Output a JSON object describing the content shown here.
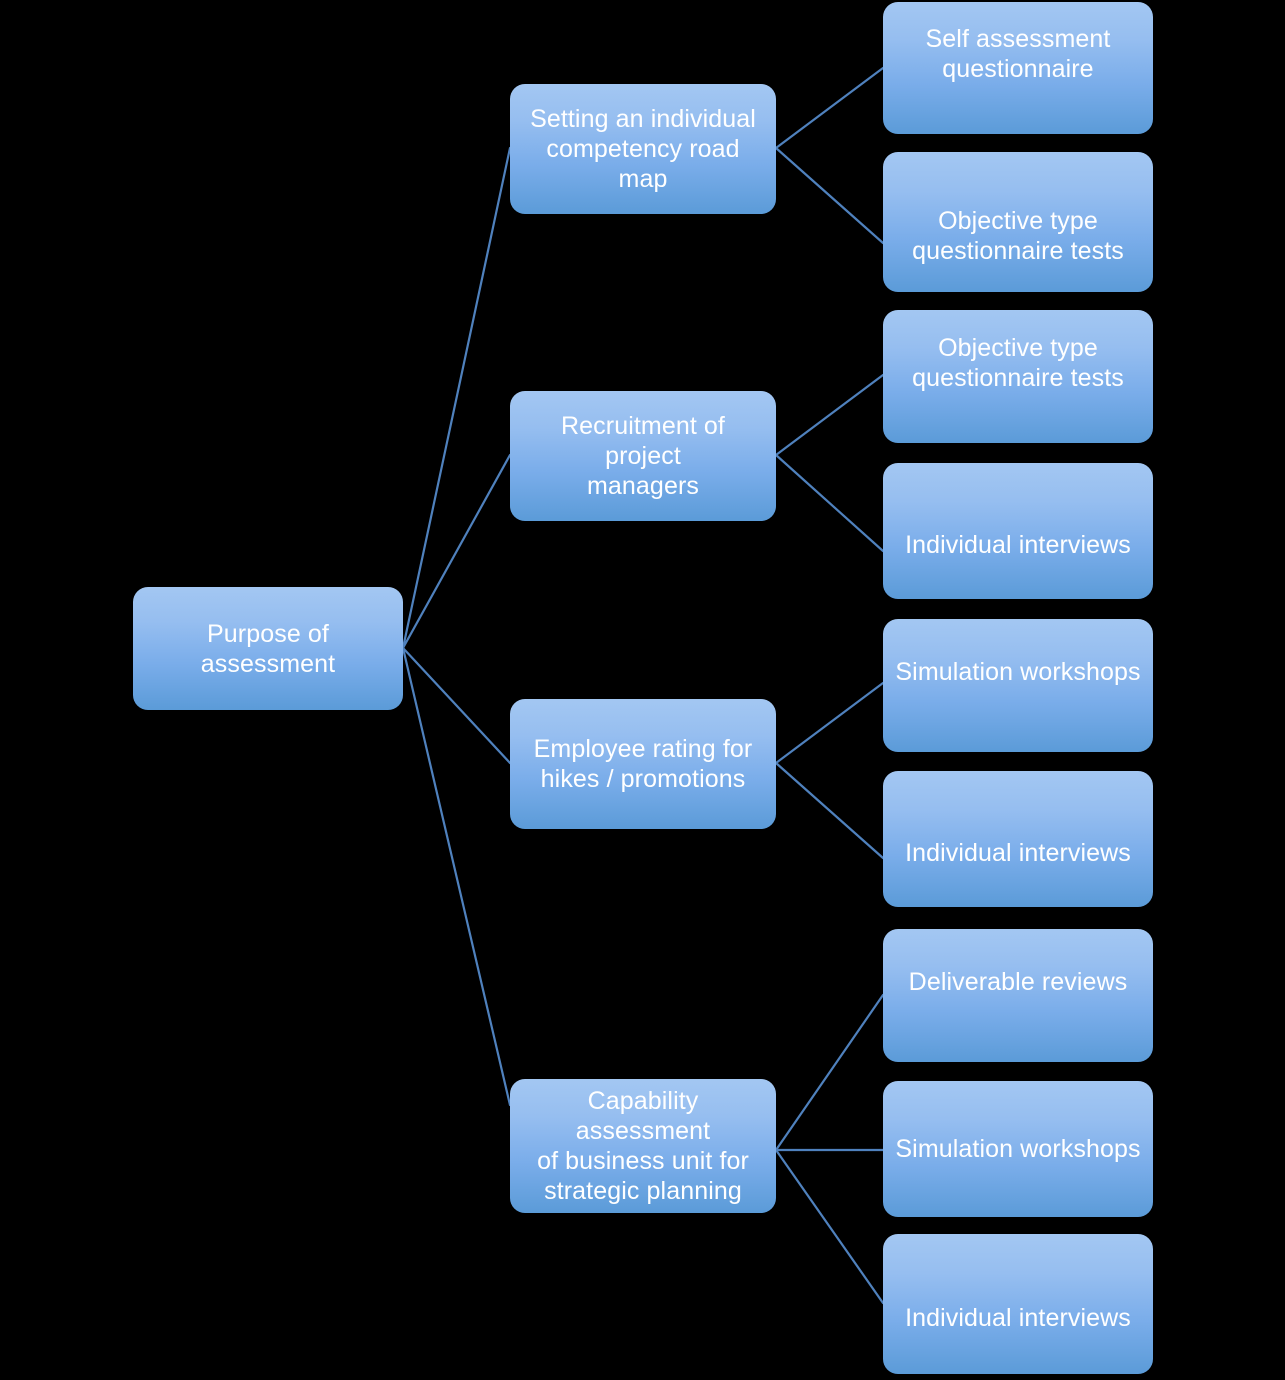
{
  "diagram": {
    "type": "tree",
    "title": "Purpose of assessment",
    "orientation": "left-to-right",
    "background_color": "#000000",
    "node_fill_top": "#a3c7f2",
    "node_fill_bottom": "#5b9bd8",
    "node_text_color": "#ffffff",
    "connector_color": "#4f81bd"
  },
  "root": {
    "label": "Purpose of assessment"
  },
  "branches": [
    {
      "label": "Setting an individual\ncompetency road map",
      "leaves": [
        {
          "label": "Self assessment\nquestionnaire"
        },
        {
          "label": "Objective type\nquestionnaire tests"
        }
      ]
    },
    {
      "label": "Recruitment of project\nmanagers",
      "leaves": [
        {
          "label": "Objective type\nquestionnaire tests"
        },
        {
          "label": "Individual interviews"
        }
      ]
    },
    {
      "label": "Employee rating for\nhikes /  promotions",
      "leaves": [
        {
          "label": "Simulation workshops"
        },
        {
          "label": "Individual interviews"
        }
      ]
    },
    {
      "label": "Capability assessment\nof business unit for\nstrategic planning",
      "leaves": [
        {
          "label": "Deliverable reviews"
        },
        {
          "label": "Simulation workshops"
        },
        {
          "label": "Individual interviews"
        }
      ]
    }
  ]
}
